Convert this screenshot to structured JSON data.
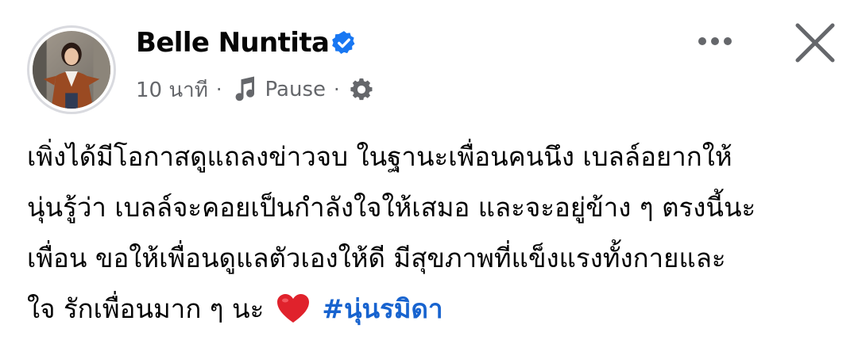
{
  "post": {
    "author": {
      "name": "Belle Nuntita",
      "verified": true
    },
    "meta": {
      "time": "10 นาที",
      "separator": "·",
      "music_label": "Pause",
      "audience_icon": "gear-icon"
    },
    "actions": {
      "more_icon": "more-horizontal-icon",
      "close_icon": "close-icon"
    },
    "body": {
      "line1": "เพิ่งได้มีโอกาสดูแถลงข่าวจบ ในฐานะเพื่อนคนนึง เบลล์อยากให้",
      "line2": "นุ่นรู้ว่า เบลล์จะคอยเป็นกำลังใจให้เสมอ และจะอยู่ข้าง ๆ ตรงนี้นะ",
      "line3": "เพื่อน ขอให้เพื่อนดูแลตัวเองให้ดี มีสุขภาพที่แข็งแรงทั้งกายและ",
      "line4_text": "ใจ รักเพื่อนมาก ๆ นะ",
      "emoji": "heart-icon",
      "hashtag": "#นุ่นรมิดา"
    },
    "colors": {
      "verified_blue": "#1877f2",
      "hashtag_blue": "#1763cf",
      "secondary_text": "#65676b",
      "heart_red": "#e0222c"
    }
  }
}
